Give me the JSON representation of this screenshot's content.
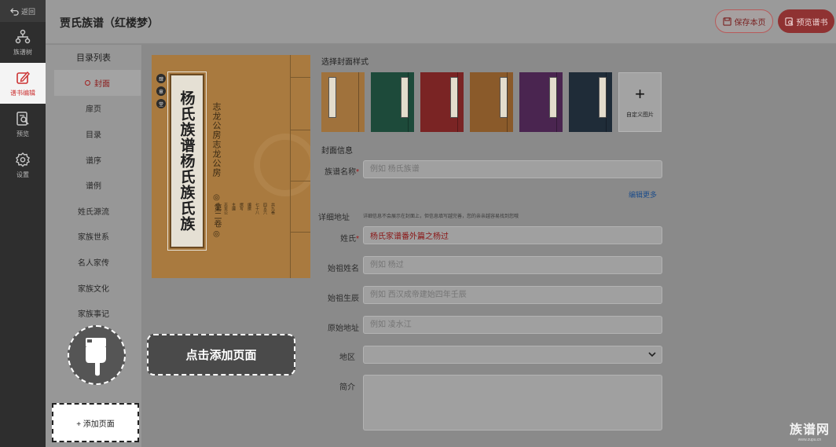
{
  "rail": {
    "back_label": "返回",
    "items": [
      {
        "label": "族谱树",
        "icon": "tree-icon"
      },
      {
        "label": "谱书编辑",
        "icon": "edit-icon"
      },
      {
        "label": "预览",
        "icon": "preview-icon"
      },
      {
        "label": "设置",
        "icon": "gear-icon"
      }
    ]
  },
  "header": {
    "title": "贾氏族谱（红楼梦）",
    "save_label": "保存本页",
    "preview_label": "预览谱书"
  },
  "toc": {
    "heading": "目录列表",
    "items": [
      "封面",
      "扉页",
      "目录",
      "谱序",
      "谱例",
      "姓氏源流",
      "家族世系",
      "名人家传",
      "家族文化",
      "家族事记"
    ],
    "active_index": 0,
    "add_page_label": "+ 添加页面"
  },
  "tip": {
    "click_add": "点击添加页面"
  },
  "cover": {
    "seals": [
      "肆",
      "章",
      "堂"
    ],
    "main_title": "杨氏族谱杨氏族氏族",
    "subtitle": "志龙公房志龙公房",
    "volume": "◎ 第二卷 ◎",
    "small_cols": [
      "共九卷",
      "四五六",
      "七十八",
      "编撰",
      "撰写",
      "主编",
      "志龙公",
      "杨氏"
    ]
  },
  "cover_style": {
    "title": "选择封面样式",
    "colors": [
      "#a0723c",
      "#1d4a3a",
      "#7a2424",
      "#8a5a2a",
      "#4a2550",
      "#1f2c38"
    ],
    "custom_label": "自定义图片"
  },
  "cover_info": {
    "title": "封面信息",
    "name_label": "族谱名称",
    "name_placeholder": "例如 杨氏族谱",
    "edit_more": "编辑更多",
    "address_label": "详细地址",
    "address_hint": "详细信息不会展示在封面上，但信息填写越完善，您的亲亲越容易找到您哦",
    "surname_label": "姓氏",
    "surname_value": "杨氏家谱番外篇之杨过",
    "ancestor_label": "始祖姓名",
    "ancestor_placeholder": "例如 杨过",
    "birth_label": "始祖生辰",
    "birth_placeholder": "例如 西汉成帝建始四年壬辰",
    "origin_label": "原始地址",
    "origin_placeholder": "例如 凌水江",
    "region_label": "地区",
    "region_value": "",
    "intro_label": "简介"
  },
  "watermark": {
    "brand": "族谱网",
    "url": "www.zupu.cn"
  }
}
